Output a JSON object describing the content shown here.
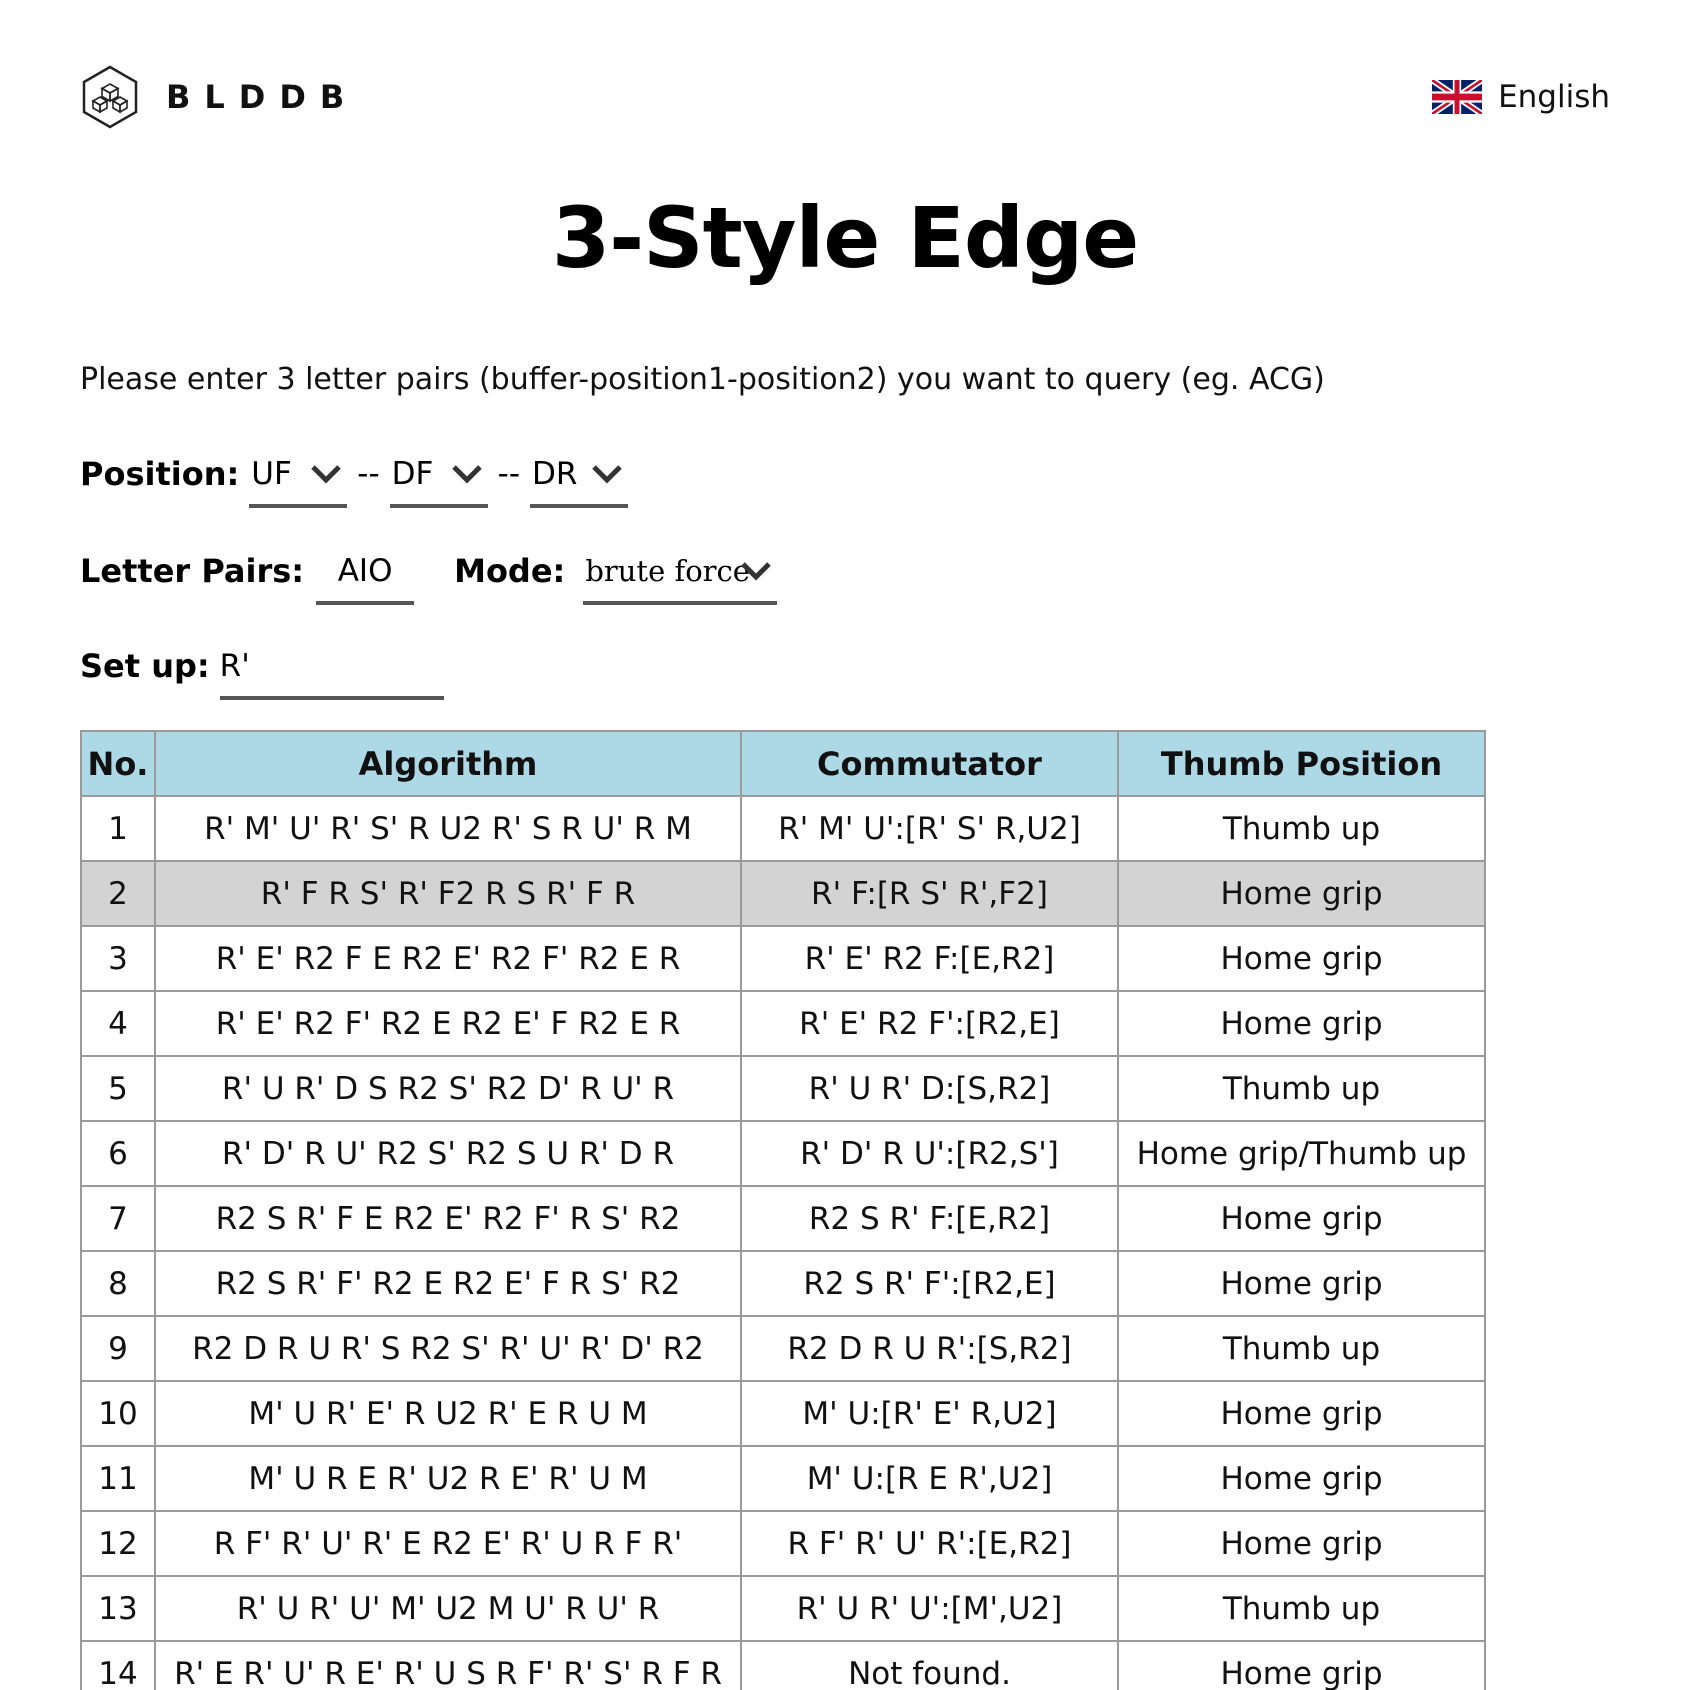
{
  "header": {
    "logo_text": "BLDDB",
    "language": "English"
  },
  "title": "3-Style Edge",
  "instructions": "Please enter 3 letter pairs (buffer-position1-position2) you want to query (eg. ACG)",
  "form": {
    "position_label": "Position:",
    "position1": "UF",
    "position2": "DF",
    "position3": "DR",
    "separator": "--",
    "letter_pairs_label": "Letter Pairs:",
    "letter_pairs_value": "AIO",
    "mode_label": "Mode:",
    "mode_value": "brute force",
    "setup_label": "Set up:",
    "setup_value": "R'"
  },
  "table": {
    "headers": [
      "No.",
      "Algorithm",
      "Commutator",
      "Thumb Position"
    ],
    "highlighted_row": 2,
    "rows": [
      [
        "1",
        "R' M' U' R' S' R U2 R' S R U' R M",
        "R' M' U':[R' S' R,U2]",
        "Thumb up"
      ],
      [
        "2",
        "R' F R S' R' F2 R S R' F R",
        "R' F:[R S' R',F2]",
        "Home grip"
      ],
      [
        "3",
        "R' E' R2 F E R2 E' R2 F' R2 E R",
        "R' E' R2 F:[E,R2]",
        "Home grip"
      ],
      [
        "4",
        "R' E' R2 F' R2 E R2 E' F R2 E R",
        "R' E' R2 F':[R2,E]",
        "Home grip"
      ],
      [
        "5",
        "R' U R' D S R2 S' R2 D' R U' R",
        "R' U R' D:[S,R2]",
        "Thumb up"
      ],
      [
        "6",
        "R' D' R U' R2 S' R2 S U R' D R",
        "R' D' R U':[R2,S']",
        "Home grip/Thumb up"
      ],
      [
        "7",
        "R2 S R' F E R2 E' R2 F' R S' R2",
        "R2 S R' F:[E,R2]",
        "Home grip"
      ],
      [
        "8",
        "R2 S R' F' R2 E R2 E' F R S' R2",
        "R2 S R' F':[R2,E]",
        "Home grip"
      ],
      [
        "9",
        "R2 D R U R' S R2 S' R' U' R' D' R2",
        "R2 D R U R':[S,R2]",
        "Thumb up"
      ],
      [
        "10",
        "M' U R' E' R U2 R' E R U M",
        "M' U:[R' E' R,U2]",
        "Home grip"
      ],
      [
        "11",
        "M' U R E R' U2 R E' R' U M",
        "M' U:[R E R',U2]",
        "Home grip"
      ],
      [
        "12",
        "R F' R' U' R' E R2 E' R' U R F R'",
        "R F' R' U' R':[E,R2]",
        "Home grip"
      ],
      [
        "13",
        "R' U R' U' M' U2 M U' R U' R",
        "R' U R' U':[M',U2]",
        "Thumb up"
      ],
      [
        "14",
        "R' E R' U' R E' R' U S R F' R' S' R F R",
        "Not found.",
        "Home grip"
      ],
      [
        "15",
        "",
        "",
        ""
      ]
    ]
  }
}
